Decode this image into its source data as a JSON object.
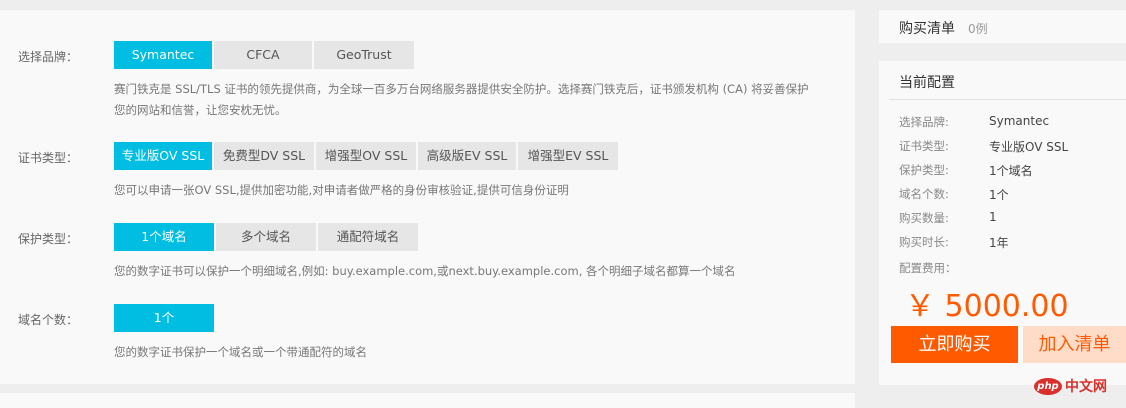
{
  "config": {
    "brand_label": "选择品牌：",
    "brand_options": [
      "Symantec",
      "CFCA",
      "GeoTrust"
    ],
    "brand_desc_line1": "赛门铁克是 SSL/TLS 证书的领先提供商，为全球一百多万台网络服务器提供安全防护。选择赛门铁克后，证书颁发机构 (CA) 将妥善保护",
    "brand_desc_line2": "您的网站和信誉，让您安枕无忧。",
    "cert_label": "证书类型：",
    "cert_options": [
      "专业版OV SSL",
      "免费型DV SSL",
      "增强型OV SSL",
      "高级版EV SSL",
      "增强型EV SSL"
    ],
    "cert_desc": "您可以申请一张OV SSL,提供加密功能,对申请者做严格的身份审核验证,提供可信身份证明",
    "protect_label": "保护类型：",
    "protect_options": [
      "1个域名",
      "多个域名",
      "通配符域名"
    ],
    "protect_desc": "您的数字证书可以保护一个明细域名,例如: buy.example.com,或next.buy.example.com, 各个明细子域名都算一个域名",
    "domain_label": "域名个数：",
    "domain_options": [
      "1个"
    ],
    "domain_desc": "您的数字证书保护一个域名或一个带通配符的域名"
  },
  "cart": {
    "title": "购买清单",
    "count": "0例"
  },
  "summary": {
    "title": "当前配置",
    "rows": [
      {
        "k": "选择品牌:",
        "v": "Symantec"
      },
      {
        "k": "证书类型:",
        "v": "专业版OV SSL"
      },
      {
        "k": "保护类型:",
        "v": "1个域名"
      },
      {
        "k": "域名个数:",
        "v": "1个"
      },
      {
        "k": "购买数量:",
        "v": "1"
      },
      {
        "k": "购买时长:",
        "v": "1年"
      }
    ],
    "fee_label": "配置费用：",
    "price": "￥ 5000.00",
    "buy_button": "立即购买",
    "add_button": "加入清单"
  },
  "watermark": {
    "badge": "php",
    "text": "中文网"
  },
  "colors": {
    "accent": "#00bde2",
    "price": "#ff5a00",
    "buy": "#ff5a00",
    "add_bg": "#ffdcc8"
  }
}
